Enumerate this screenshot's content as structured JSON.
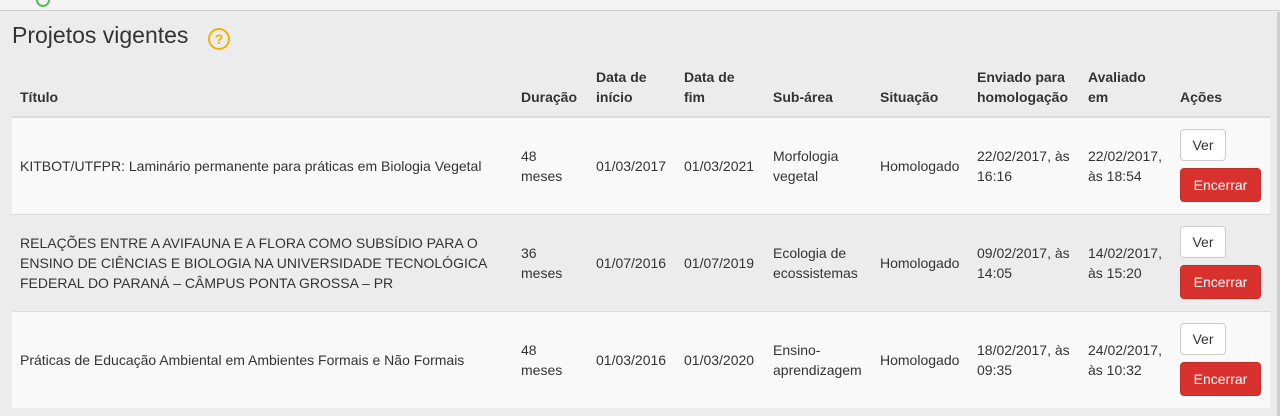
{
  "page": {
    "title": "Projetos vigentes",
    "help_icon": "?"
  },
  "table": {
    "headers": {
      "titulo": "Título",
      "duracao": "Duração",
      "data_inicio": "Data de início",
      "data_fim": "Data de fim",
      "sub_area": "Sub-área",
      "situacao": "Situação",
      "enviado": "Enviado para homologação",
      "avaliado": "Avaliado em",
      "acoes": "Ações"
    },
    "rows": [
      {
        "titulo": "KITBOT/UTFPR: Laminário permanente para práticas em Biologia Vegetal",
        "duracao": "48 meses",
        "data_inicio": "01/03/2017",
        "data_fim": "01/03/2021",
        "sub_area": "Morfologia vegetal",
        "situacao": "Homologado",
        "enviado": "22/02/2017, às 16:16",
        "avaliado": "22/02/2017, às 18:54",
        "ver_label": "Ver",
        "encerrar_label": "Encerrar"
      },
      {
        "titulo": "RELAÇÕES ENTRE A AVIFAUNA E A FLORA COMO SUBSÍDIO PARA O ENSINO DE CIÊNCIAS E BIOLOGIA NA UNIVERSIDADE TECNOLÓGICA FEDERAL DO PARANÁ – CÂMPUS PONTA GROSSA – PR",
        "duracao": "36 meses",
        "data_inicio": "01/07/2016",
        "data_fim": "01/07/2019",
        "sub_area": "Ecologia de ecossistemas",
        "situacao": "Homologado",
        "enviado": "09/02/2017, às 14:05",
        "avaliado": "14/02/2017, às 15:20",
        "ver_label": "Ver",
        "encerrar_label": "Encerrar"
      },
      {
        "titulo": "Práticas de Educação Ambiental em Ambientes Formais e Não Formais",
        "duracao": "48 meses",
        "data_inicio": "01/03/2016",
        "data_fim": "01/03/2020",
        "sub_area": "Ensino-aprendizagem",
        "situacao": "Homologado",
        "enviado": "18/02/2017, às 09:35",
        "avaliado": "24/02/2017, às 10:32",
        "ver_label": "Ver",
        "encerrar_label": "Encerrar"
      }
    ]
  },
  "colors": {
    "danger": "#d9312e",
    "help": "#f0b400",
    "status_ok": "#5cb85c"
  }
}
